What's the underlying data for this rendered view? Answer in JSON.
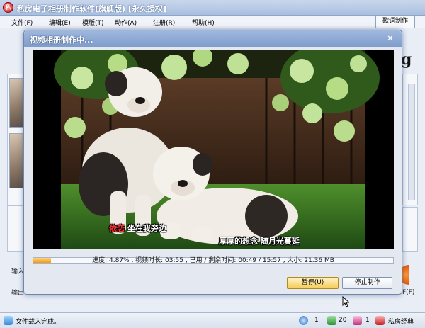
{
  "window": {
    "app_icon_letter": "私",
    "title": "私房电子相册制作软件(旗舰版) [永久授权]"
  },
  "menu": {
    "items": [
      "文件(F)",
      "编辑(E)",
      "模版(T)",
      "动作(A)",
      "注册(R)",
      "帮助(H)"
    ],
    "lyrics_button": "歌词制作"
  },
  "background_labels": {
    "left_label_a": "输入",
    "left_label_b": "输出",
    "right_label": "F(F)",
    "brand_letter": "g"
  },
  "status": {
    "message": "文件载入完成。",
    "count_a": "1",
    "count_b": "20",
    "count_c": "1",
    "brand": "私房经典"
  },
  "dialog": {
    "title": "视频相册制作中...",
    "close": "×",
    "lyrics": {
      "line1_sung": "依恋",
      "line1_rest": " 坐在我旁边",
      "line2": "厚厚的想念  随月光蔓延"
    },
    "progress": {
      "percent": 4.87,
      "text": "进度: 4.87% , 视频时长: 03:55 , 已用 / 剩余时间: 00:49 / 15:57 , 大小: 21.36 MB"
    },
    "buttons": {
      "pause": "暂停(U)",
      "stop": "停止制作"
    }
  },
  "colors": {
    "title_bar": "#9fb8de",
    "progress_fill": "#f29a1a",
    "sung_lyric": "#ff3030",
    "pause_button": "#f6cc5a"
  }
}
